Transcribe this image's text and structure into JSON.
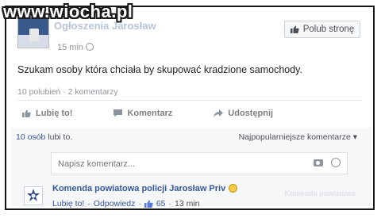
{
  "watermark": "www.wiocha.pl",
  "post": {
    "page_name": "Ogłoszenia Jarosław",
    "time": "15 min",
    "like_page_button": "Polub stronę",
    "text": "Szukam osoby która chciała by skupować kradzione samochody.",
    "stats": "10 polubień · 2 komentarzy"
  },
  "actions": {
    "like": "Lubię to!",
    "comment": "Komentarz",
    "share": "Udostępnij"
  },
  "comments_header": {
    "likers": "10 osób",
    "likers_suffix": "lubi to.",
    "sort": "Najpopularniejsze komentarze ▾"
  },
  "comment_input": {
    "placeholder": "Napisz komentarz..."
  },
  "comment": {
    "author": "Komenda powiatowa policji Jarosław Priv",
    "like": "Lubię to!",
    "reply": "Odpowiedz",
    "likes": "65",
    "time": "13 min"
  },
  "faded_label": "Komenda powiatowa"
}
